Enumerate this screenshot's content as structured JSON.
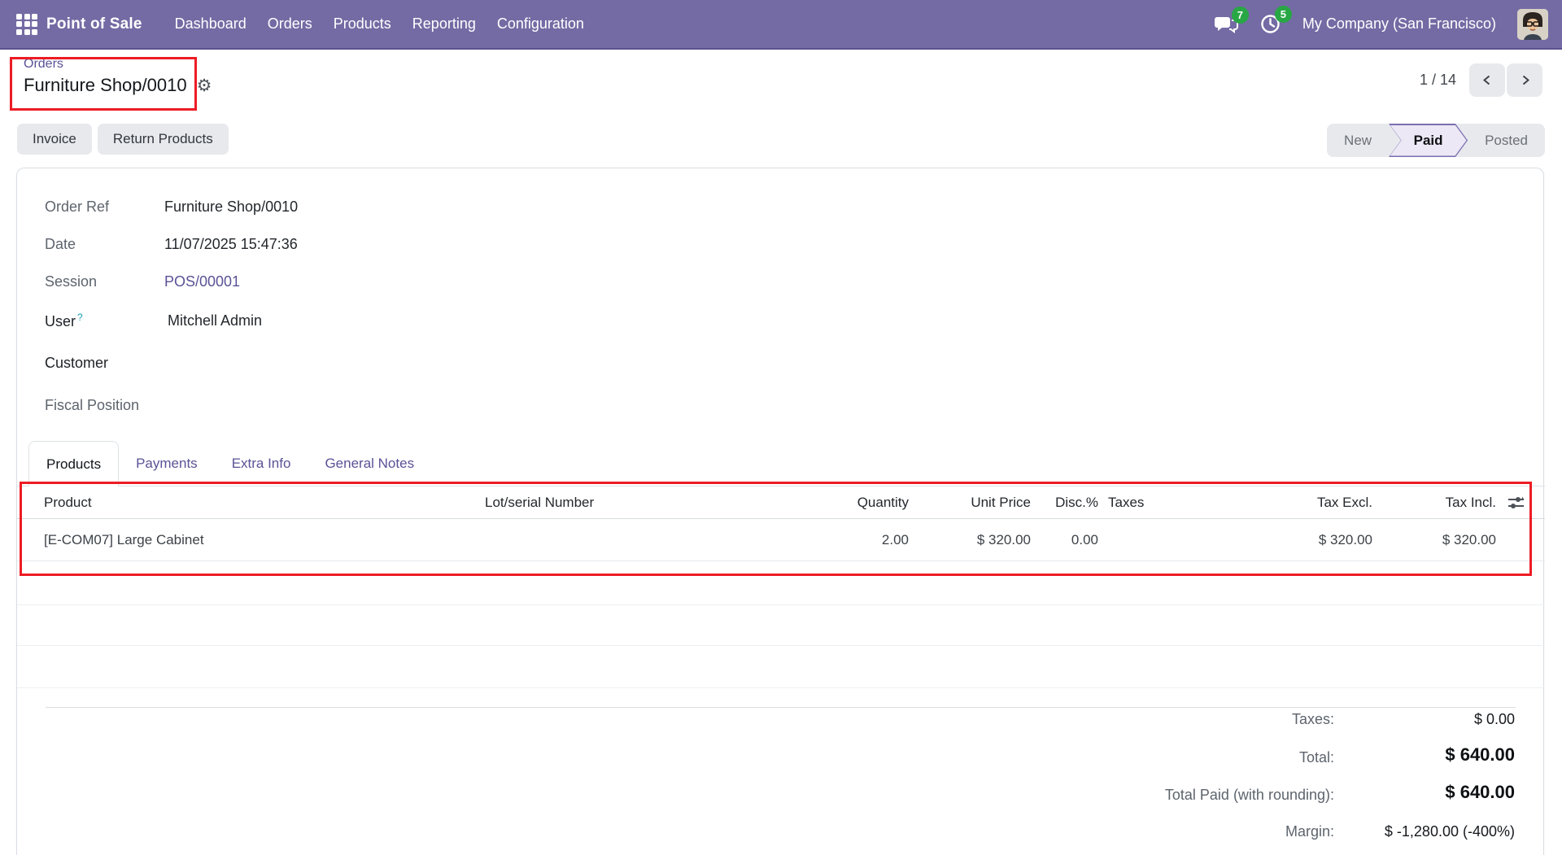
{
  "colors": {
    "navbar_bg": "#746BA4",
    "navbar_border": "#5d5291",
    "badge_green": "#28a745",
    "link": "#5a5296",
    "status_active_bg": "#ece8f5",
    "status_active_border": "#7b6db0",
    "annotation_red": "#ED1C24"
  },
  "navbar": {
    "app_name": "Point of Sale",
    "menu": [
      "Dashboard",
      "Orders",
      "Products",
      "Reporting",
      "Configuration"
    ],
    "messages_badge": "7",
    "activities_badge": "5",
    "company": "My Company (San Francisco)"
  },
  "breadcrumb": {
    "parent": "Orders",
    "current": "Furniture Shop/0010"
  },
  "pager": {
    "value": "1 / 14"
  },
  "actions": {
    "invoice": "Invoice",
    "return_products": "Return Products"
  },
  "statusbar": {
    "new": "New",
    "paid": "Paid",
    "posted": "Posted"
  },
  "form": {
    "order_ref": {
      "label": "Order Ref",
      "value": "Furniture Shop/0010"
    },
    "date": {
      "label": "Date",
      "value": "11/07/2025 15:47:36"
    },
    "session": {
      "label": "Session",
      "value": "POS/00001"
    },
    "user": {
      "label": "User",
      "help": "?",
      "value": "Mitchell Admin"
    },
    "customer": {
      "label": "Customer",
      "value": ""
    },
    "fiscal_position": {
      "label": "Fiscal Position",
      "value": ""
    }
  },
  "tabs": {
    "products": "Products",
    "payments": "Payments",
    "extra_info": "Extra Info",
    "general_notes": "General Notes"
  },
  "table": {
    "headers": {
      "product": "Product",
      "lot": "Lot/serial Number",
      "quantity": "Quantity",
      "unit_price": "Unit Price",
      "disc": "Disc.%",
      "taxes": "Taxes",
      "tax_excl": "Tax Excl.",
      "tax_incl": "Tax Incl."
    },
    "rows": [
      {
        "product": "[E-COM07] Large Cabinet",
        "lot": "",
        "quantity": "2.00",
        "unit_price": "$ 320.00",
        "disc": "0.00",
        "taxes": "",
        "tax_excl": "$ 320.00",
        "tax_incl": "$ 320.00"
      }
    ]
  },
  "totals": {
    "taxes_label": "Taxes:",
    "taxes_value": "$ 0.00",
    "total_label": "Total:",
    "total_value": "$ 640.00",
    "paid_label": "Total Paid (with rounding):",
    "paid_value": "$ 640.00",
    "margin_label": "Margin:",
    "margin_value": "$ -1,280.00 (-400%)"
  }
}
